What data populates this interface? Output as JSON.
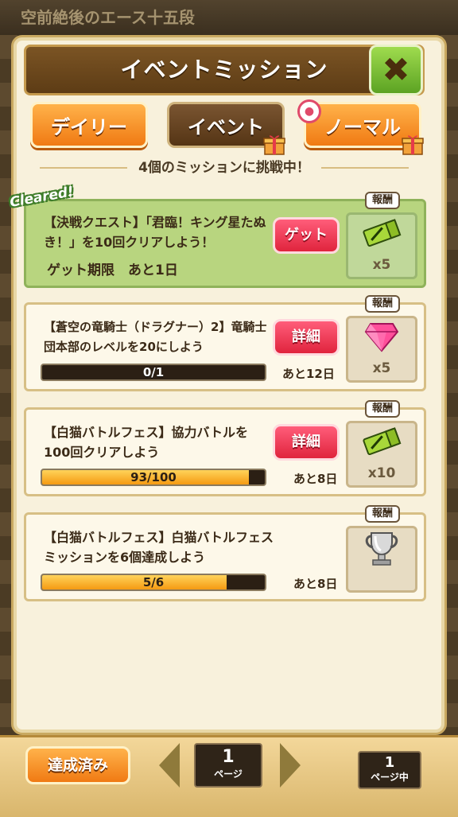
{
  "background": {
    "header_text": "空前絶後のエース十五段"
  },
  "title": "イベントミッション",
  "tabs": [
    {
      "label": "デイリー",
      "active": false
    },
    {
      "label": "イベント",
      "active": true
    },
    {
      "label": "ノーマル",
      "active": false
    }
  ],
  "challenge_text": "4個のミッションに挑戦中！",
  "reward_label": "報酬",
  "missions": [
    {
      "badge": "Cleared!",
      "text": "【決戦クエスト】「君臨！キング星たぬき！」を10回クリアしよう！",
      "deadline": "ゲット期限　あと1日",
      "button": "ゲット",
      "reward_icon": "ticket-icon",
      "reward_qty": "x5"
    },
    {
      "text": "【蒼空の竜騎士（ドラグナー）2】竜騎士団本部のレベルを20にしよう",
      "progress_text": "0/1",
      "progress": 0,
      "button": "詳細",
      "remaining": "あと12日",
      "reward_icon": "gem-icon",
      "reward_qty": "x5"
    },
    {
      "text": "【白猫バトルフェス】協力バトルを100回クリアしよう",
      "progress_text": "93/100",
      "progress": 0.93,
      "button": "詳細",
      "remaining": "あと8日",
      "reward_icon": "ticket-icon",
      "reward_qty": "x10"
    },
    {
      "text": "【白猫バトルフェス】白猫バトルフェスミッションを6個達成しよう",
      "progress_text": "5/6",
      "progress": 0.83,
      "remaining": "あと8日",
      "reward_icon": "trophy-icon",
      "reward_qty": ""
    }
  ],
  "bottom": {
    "completed_label": "達成済み",
    "current_page": "1",
    "page_unit": "ページ",
    "total_pages": "1",
    "total_unit": "ページ中"
  },
  "colors": {
    "accent_orange": "#f07a13",
    "title_brown": "#5d3c15",
    "close_green": "#5ca323",
    "action_red": "#e0243d",
    "cleared_green": "#b8d57f"
  }
}
